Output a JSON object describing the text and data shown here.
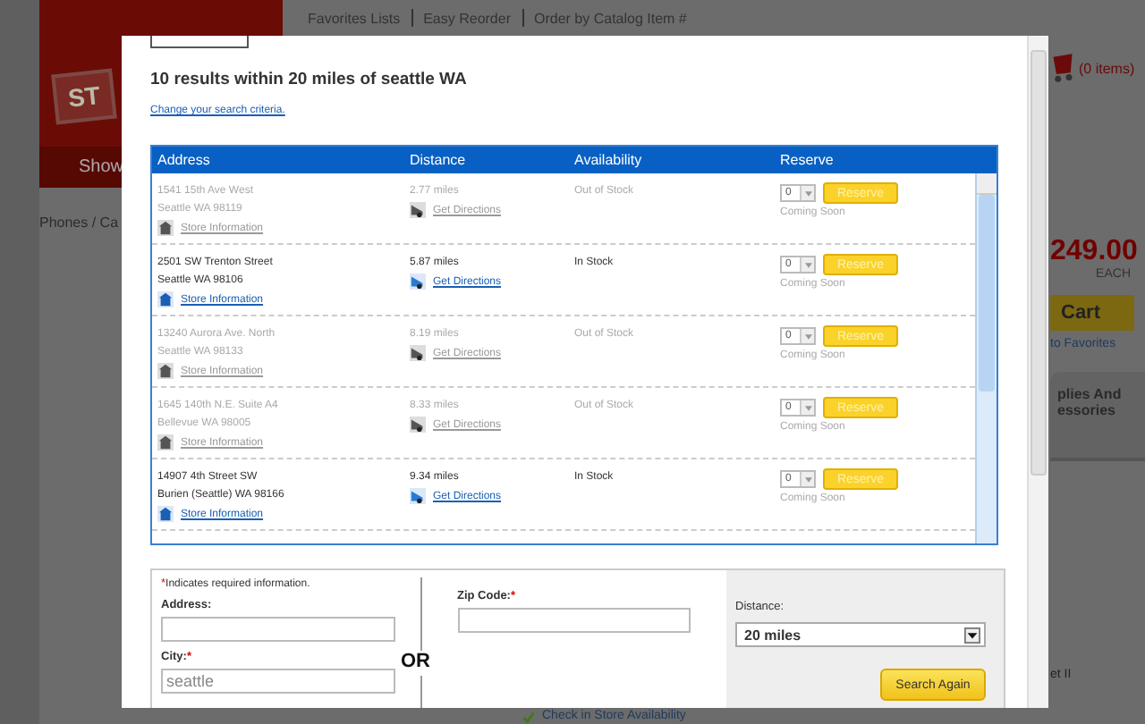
{
  "background_page": {
    "logo_text": "ST",
    "logo_bar": "Show",
    "nav_links": [
      "Favorites Lists",
      "Easy Reorder",
      "Order by Catalog Item #"
    ],
    "cart_count": "(0 items)",
    "breadcrumb": "Phones / Ca",
    "price": "249.00",
    "price_unit": "EACH",
    "cart_button": "Cart",
    "favorites_link": "to Favorites",
    "tab_lines": [
      "plies And",
      "essories"
    ],
    "panel_text": "et II",
    "availability_link": "Check in Store Availability"
  },
  "dialog": {
    "title": "10 results within 20 miles of seattle WA",
    "change_link": "Change your search criteria.",
    "table": {
      "columns": [
        "Address",
        "Distance",
        "Availability",
        "Reserve"
      ],
      "rows": [
        {
          "line1": "1541 15th Ave West",
          "line2": "Seattle WA 98119",
          "store_link": "Store Information",
          "distance": "2.77 miles",
          "directions_link": "Get Directions",
          "availability": "Out of Stock",
          "in_stock": false,
          "quantity": "0",
          "reserve": "Reserve",
          "note": "Coming Soon"
        },
        {
          "line1": "2501 SW Trenton Street",
          "line2": "Seattle WA 98106",
          "store_link": "Store Information",
          "distance": "5.87 miles",
          "directions_link": "Get Directions",
          "availability": "In Stock",
          "in_stock": true,
          "quantity": "0",
          "reserve": "Reserve",
          "note": "Coming Soon"
        },
        {
          "line1": "13240 Aurora Ave. North",
          "line2": "Seattle WA 98133",
          "store_link": "Store Information",
          "distance": "8.19 miles",
          "directions_link": "Get Directions",
          "availability": "Out of Stock",
          "in_stock": false,
          "quantity": "0",
          "reserve": "Reserve",
          "note": "Coming Soon"
        },
        {
          "line1": "1645 140th N.E. Suite A4",
          "line2": "Bellevue WA 98005",
          "store_link": "Store Information",
          "distance": "8.33 miles",
          "directions_link": "Get Directions",
          "availability": "Out of Stock",
          "in_stock": false,
          "quantity": "0",
          "reserve": "Reserve",
          "note": "Coming Soon"
        },
        {
          "line1": "14907 4th Street SW",
          "line2": "Burien (Seattle) WA 98166",
          "store_link": "Store Information",
          "distance": "9.34 miles",
          "directions_link": "Get Directions",
          "availability": "In Stock",
          "in_stock": true,
          "quantity": "0",
          "reserve": "Reserve",
          "note": "Coming Soon"
        }
      ]
    },
    "form": {
      "required_mark": "*",
      "required_note": "Indicates required information.",
      "address_label": "Address:",
      "city_label": "City:",
      "city_value": "seattle",
      "or_text": "OR",
      "zip_label": "Zip Code:",
      "distance_label": "Distance:",
      "distance_value": "20 miles",
      "search_button": "Search Again"
    }
  }
}
